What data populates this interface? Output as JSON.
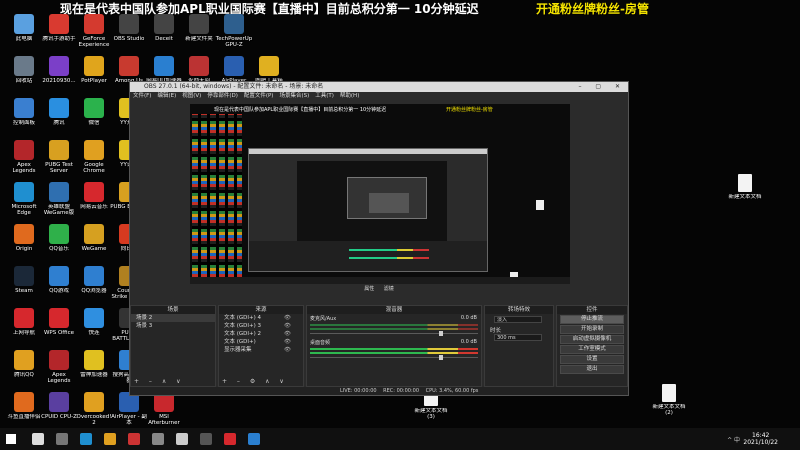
{
  "stream": {
    "title": "现在是代表中国队参加APL职业国际赛【直播中】目前总积分第一 10分钟延迟",
    "tag": "开通粉丝牌粉丝-房管"
  },
  "desktop": {
    "icons": [
      {
        "label": "此电脑",
        "color": "#5aa0e0"
      },
      {
        "label": "腾讯手游助手",
        "color": "#d93a30"
      },
      {
        "label": "GeForce Experience",
        "color": "#d43a2f"
      },
      {
        "label": "OBS Studio",
        "color": "#444"
      },
      {
        "label": "Deceit",
        "color": "#444"
      },
      {
        "label": "新建文件夹",
        "color": "#444"
      },
      {
        "label": "TechPowerUp GPU-Z",
        "color": "#2e5f8e"
      },
      {
        "label": "回收站",
        "color": "#6a7a8a"
      },
      {
        "label": "20210930...",
        "color": "#7b3fc8"
      },
      {
        "label": "PotPlayer",
        "color": "#e0a51c"
      },
      {
        "label": "Among Us",
        "color": "#c83a2f"
      },
      {
        "label": "网易UU加速器",
        "color": "#2a7fd0"
      },
      {
        "label": "永劫无间",
        "color": "#b33"
      },
      {
        "label": "AirPlayer",
        "color": "#2a5fb0"
      },
      {
        "label": "图吧工具箱2021",
        "color": "#e0b020"
      },
      {
        "label": "控制面板",
        "color": "#3a7fd0"
      },
      {
        "label": "腾讯",
        "color": "#2a8fe0"
      },
      {
        "label": "微信",
        "color": "#2bb24c"
      },
      {
        "label": "YY开播",
        "color": "#e0c020"
      },
      {
        "label": "Apex Legends",
        "color": "#b3262a"
      },
      {
        "label": "PUBG Test Server",
        "color": "#d8a020"
      },
      {
        "label": "Google Chrome",
        "color": "#e0a020"
      },
      {
        "label": "YY语音",
        "color": "#e0c020"
      },
      {
        "label": "Microsoft Edge",
        "color": "#1f8fd0"
      },
      {
        "label": "英雄联盟WeGame版",
        "color": "#2f6fb0"
      },
      {
        "label": "网易云音乐",
        "color": "#d6282d"
      },
      {
        "label": "PUBG Esports",
        "color": "#d8a020"
      },
      {
        "label": "Origin",
        "color": "#e06a1e"
      },
      {
        "label": "QQ音乐",
        "color": "#2fb04a"
      },
      {
        "label": "WeGame",
        "color": "#d6a020"
      },
      {
        "label": "向日葵",
        "color": "#d63a20"
      },
      {
        "label": "Steam",
        "color": "#1b2838"
      },
      {
        "label": "QQ游戏",
        "color": "#2f7fd0"
      },
      {
        "label": "QQ浏览器",
        "color": "#2f7fd0"
      },
      {
        "label": "Counter-Strike Global Offe...",
        "color": "#b08020"
      },
      {
        "label": "上网导航",
        "color": "#d6282d"
      },
      {
        "label": "WPS Office",
        "color": "#d6282d"
      },
      {
        "label": "快连",
        "color": "#2f8fe0"
      },
      {
        "label": "PUBG BATTLEGR...",
        "color": "#333"
      },
      {
        "label": "腾讯QQ",
        "color": "#e0a020"
      },
      {
        "label": "Apex Legends",
        "color": "#b3262a"
      },
      {
        "label": "雷神加速器",
        "color": "#e0c020"
      },
      {
        "label": "搜狗高速浏览器",
        "color": "#2f7fd0"
      },
      {
        "label": "斗鱼直播伴侣",
        "color": "#e06a1e"
      },
      {
        "label": "CPUID CPU-Z",
        "color": "#5a3fa0"
      },
      {
        "label": "Overcooked! 2",
        "color": "#e0a020"
      },
      {
        "label": "AirPlayer - 副本",
        "color": "#2a5fb0"
      },
      {
        "label": "MSI Afterburner",
        "color": "#c8282d"
      }
    ],
    "files": [
      {
        "label": "新建文本文档"
      },
      {
        "label": "新建文本文档 (3)"
      },
      {
        "label": "新建文本文档 (2)"
      }
    ]
  },
  "obs": {
    "title": "OBS 27.0.1 (64-bit, windows) - 配置文件: 未命名 - 场景: 未命名",
    "menu": [
      "文件(F)",
      "编辑(E)",
      "视图(V)",
      "停靠部件(D)",
      "配置文件(P)",
      "场景集合(S)",
      "工具(T)",
      "帮助(H)"
    ],
    "preview_title": "现在是代表中国队参加APL职业国际赛【直播中】目前总积分第一 10分钟延迟",
    "preview_tag": "开通粉丝牌粉丝-房管",
    "ctrl_row": [
      "属性",
      "滤镜"
    ],
    "scenes_header": "场景",
    "scenes": [
      "场景 2",
      "场景 3"
    ],
    "sources_header": "来源",
    "sources": [
      "文本 (GDI+) 4",
      "文本 (GDI+) 3",
      "文本 (GDI+) 2",
      "文本 (GDI+)",
      "显示器采集"
    ],
    "mixer_header": "混音器",
    "mixer": [
      {
        "name": "麦克风/Aux",
        "db": "0.0 dB"
      },
      {
        "name": "桌面音频",
        "db": "0.0 dB"
      }
    ],
    "transitions_header": "转场特效",
    "transition_type": "淡入",
    "duration_label": "时长",
    "duration_value": "300 ms",
    "controls_header": "控件",
    "controls": [
      "停止推流",
      "开始录制",
      "启动虚拟摄像机",
      "工作室模式",
      "设置",
      "退出"
    ],
    "status": [
      "LIVE: 00:00:00",
      "REC: 00:00:00",
      "CPU: 3.4%, 60.00 fps"
    ]
  },
  "taskbar": {
    "time": "16:42",
    "date": "2021/10/22",
    "tray": "^ 中"
  }
}
